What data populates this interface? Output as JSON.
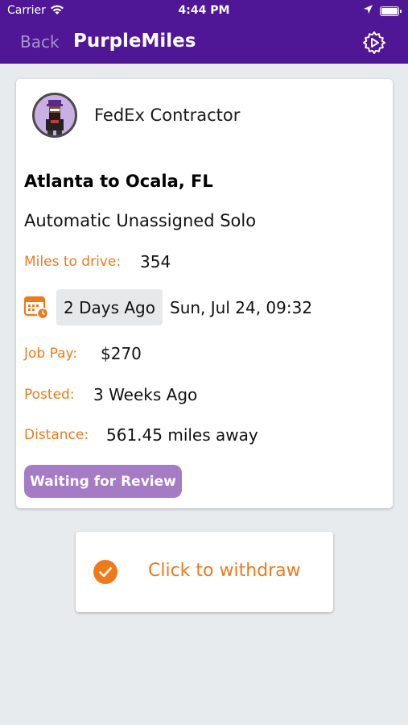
{
  "status_bar": {
    "carrier": "Carrier",
    "time": "4:44 PM"
  },
  "nav": {
    "back_label": "Back",
    "title": "PurpleMiles",
    "settings_icon": "settings-gear-icon"
  },
  "job": {
    "company": "FedEx Contractor",
    "route": "Atlanta to Ocala, FL",
    "type": "Automatic Unassigned Solo",
    "miles_label": "Miles to drive:",
    "miles_value": "354",
    "date_relative": "2 Days Ago",
    "date_absolute": "Sun, Jul 24, 09:32",
    "pay_label": "Job Pay:",
    "pay_value": "$270",
    "posted_label": "Posted:",
    "posted_value": "3 Weeks Ago",
    "distance_label": "Distance:",
    "distance_value": "561.45 miles away",
    "status": "Waiting for Review"
  },
  "actions": {
    "withdraw_label": "Click to withdraw"
  },
  "colors": {
    "brand_purple": "#4f1796",
    "accent_orange": "#f07a1a",
    "badge_purple": "#a47bc4",
    "background": "#e8ebee"
  }
}
